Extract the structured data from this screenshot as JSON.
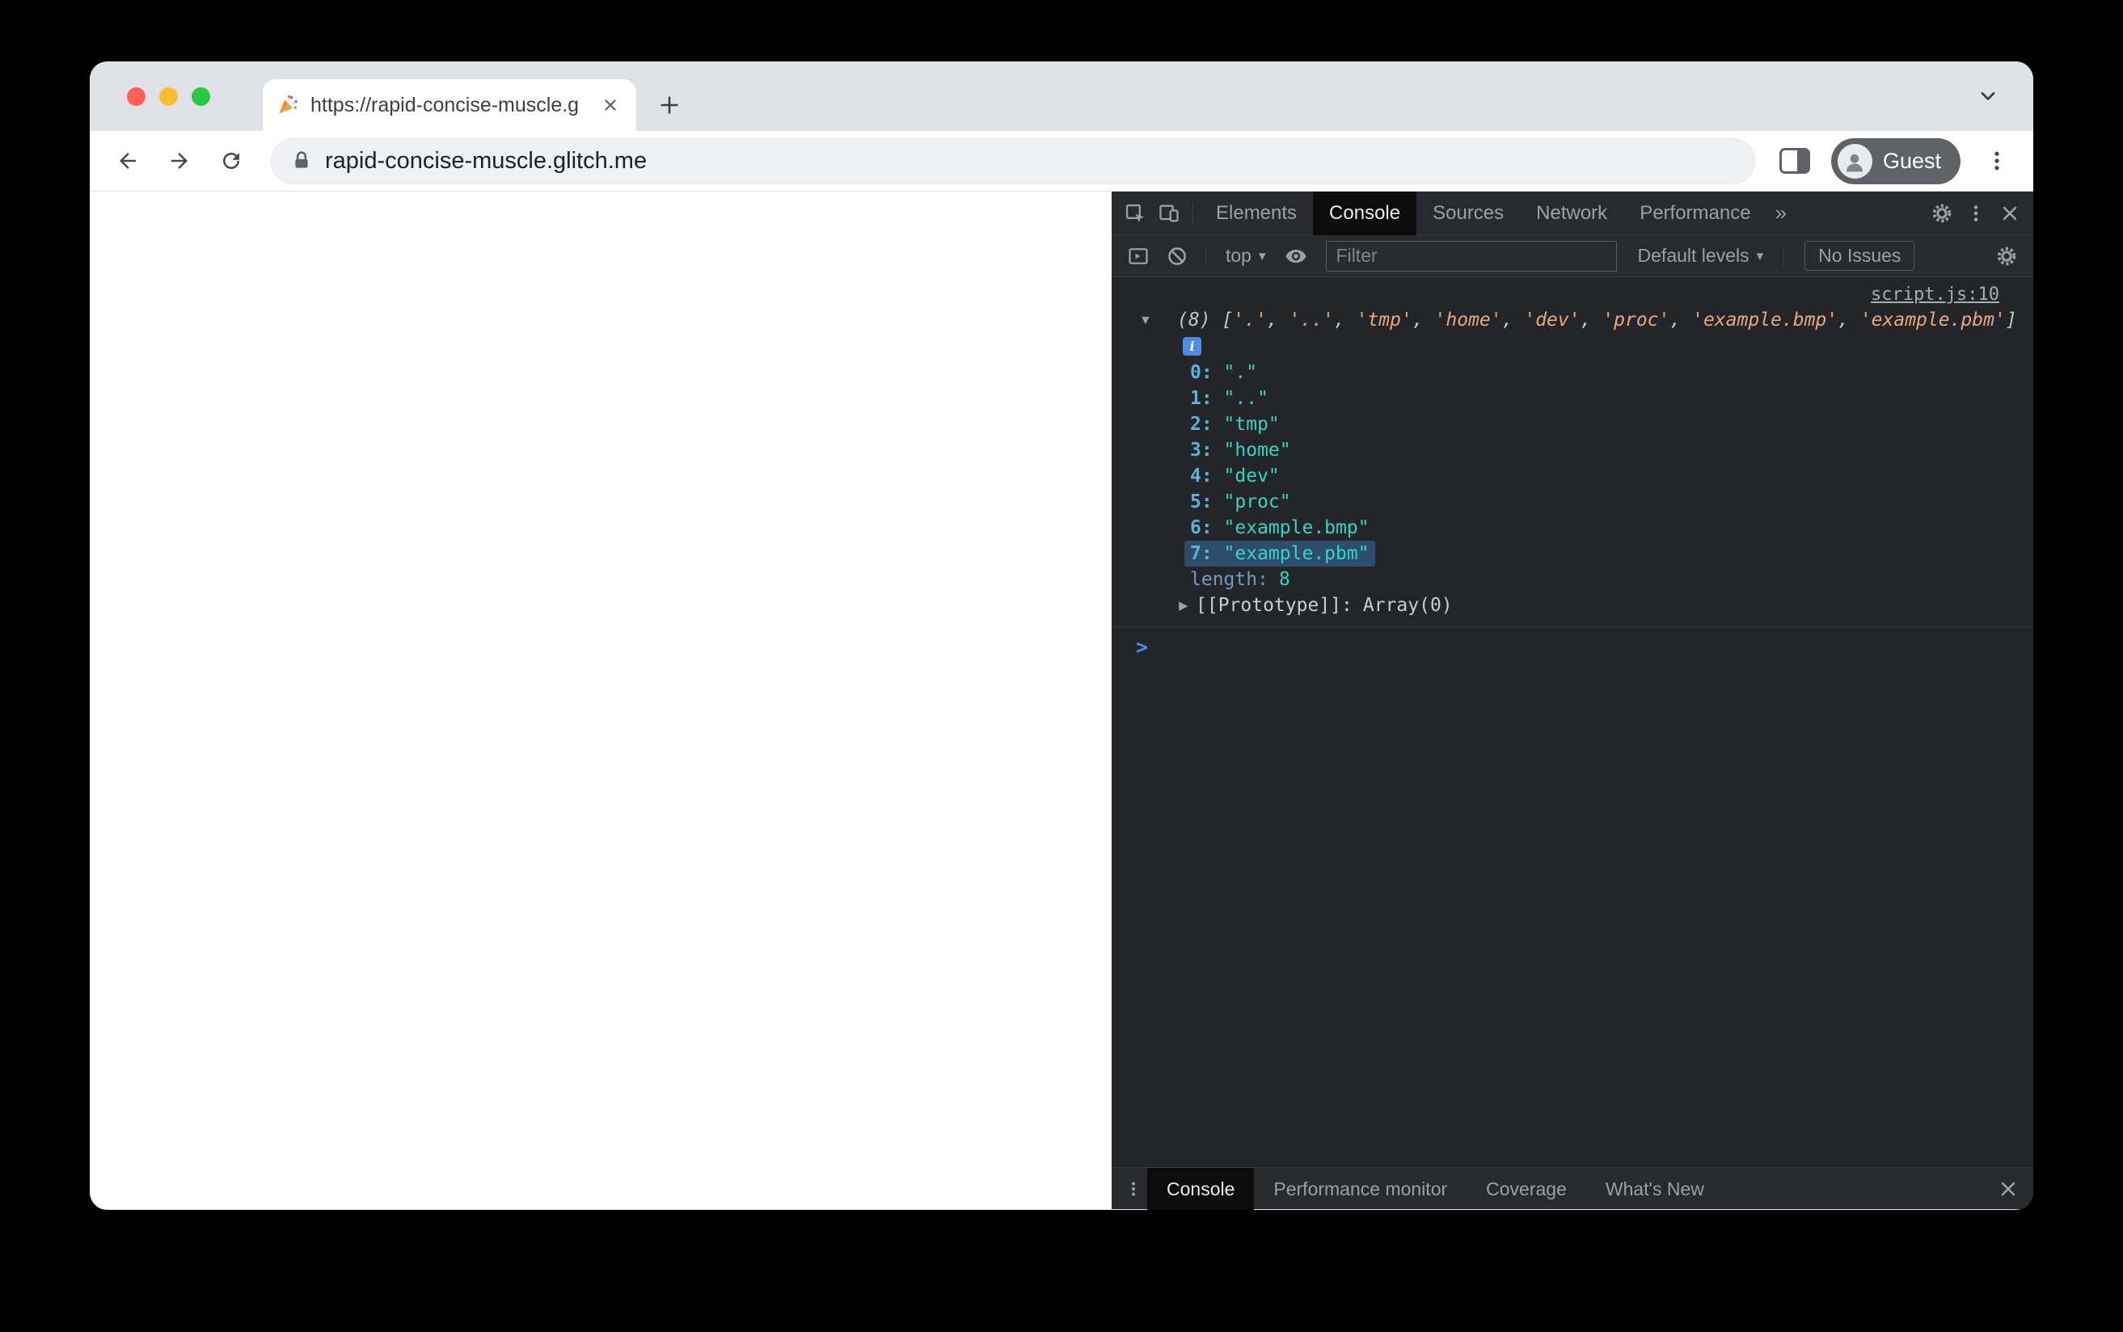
{
  "browser": {
    "tab_title": "https://rapid-concise-muscle.g",
    "url": "rapid-concise-muscle.glitch.me",
    "guest_label": "Guest"
  },
  "ui": {
    "dropdown_caret": "▾",
    "expand_caret": "▼",
    "collapsed_caret": "▶"
  },
  "devtools": {
    "tabs": [
      "Elements",
      "Console",
      "Sources",
      "Network",
      "Performance"
    ],
    "active_tab": "Console",
    "more_tabs_symbol": "»",
    "console_toolbar": {
      "context_label": "top",
      "filter_placeholder": "Filter",
      "levels_label": "Default levels",
      "issues_label": "No Issues"
    },
    "console": {
      "source_link": "script.js:10",
      "info_badge": "i",
      "preview_segments": [
        {
          "t": "(8) ",
          "c": "meta"
        },
        {
          "t": "[",
          "c": "punct"
        },
        {
          "t": "'.'",
          "c": "str"
        },
        {
          "t": ", ",
          "c": "punct"
        },
        {
          "t": "'..'",
          "c": "str"
        },
        {
          "t": ", ",
          "c": "punct"
        },
        {
          "t": "'tmp'",
          "c": "str"
        },
        {
          "t": ", ",
          "c": "punct"
        },
        {
          "t": "'home'",
          "c": "str"
        },
        {
          "t": ", ",
          "c": "punct"
        },
        {
          "t": "'dev'",
          "c": "str"
        },
        {
          "t": ", ",
          "c": "punct"
        },
        {
          "t": "'proc'",
          "c": "str"
        },
        {
          "t": ", ",
          "c": "punct"
        },
        {
          "t": "'example.bmp'",
          "c": "str"
        },
        {
          "t": ", ",
          "c": "punct"
        },
        {
          "t": "'example.pbm'",
          "c": "str"
        },
        {
          "t": "]",
          "c": "punct"
        }
      ],
      "entries": [
        {
          "index": "0",
          "value": "\".\""
        },
        {
          "index": "1",
          "value": "\"..\""
        },
        {
          "index": "2",
          "value": "\"tmp\""
        },
        {
          "index": "3",
          "value": "\"home\""
        },
        {
          "index": "4",
          "value": "\"dev\""
        },
        {
          "index": "5",
          "value": "\"proc\""
        },
        {
          "index": "6",
          "value": "\"example.bmp\""
        },
        {
          "index": "7",
          "value": "\"example.pbm\"",
          "highlighted": true
        }
      ],
      "length_label": "length:",
      "length_value": "8",
      "prototype_label": "[[Prototype]]:",
      "prototype_value": "Array(0)",
      "prompt_symbol": ">"
    },
    "drawer": {
      "tabs": [
        "Console",
        "Performance monitor",
        "Coverage",
        "What's New"
      ],
      "active_tab": "Console"
    }
  },
  "colors": {
    "accent_blue": "#4e8de6",
    "index_blue": "#5db0d7",
    "string_teal": "#35d4c7",
    "preview_orange": "#e8a87c",
    "devtools_bg": "#242528",
    "devtools_bar_bg": "#292a2d",
    "traffic_red": "#ff5f57",
    "traffic_yellow": "#febc2e",
    "traffic_green": "#28c840"
  }
}
